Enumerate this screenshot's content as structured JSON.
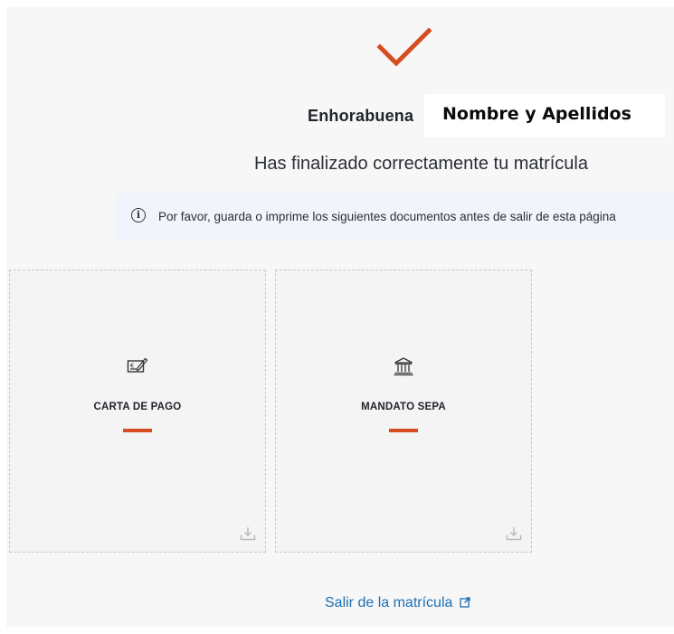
{
  "header": {
    "congrats_text": "Enhorabuena",
    "name_label": "Nombre y Apellidos",
    "subtitle": "Has finalizado correctamente tu matrícula"
  },
  "info_banner": {
    "text": "Por favor, guarda o imprime los siguientes documentos antes de salir de esta página",
    "icon": "info-icon"
  },
  "documents": [
    {
      "label": "CARTA DE PAGO",
      "icon": "payment-check-icon"
    },
    {
      "label": "MANDATO SEPA",
      "icon": "bank-icon"
    }
  ],
  "footer": {
    "exit_link": "Salir de la matrícula",
    "exit_icon": "external-link-icon"
  },
  "colors": {
    "accent": "#d64d21",
    "link": "#1f6fb2",
    "banner_bg": "#f1f5fb",
    "panel_bg": "#f7f7f7"
  }
}
